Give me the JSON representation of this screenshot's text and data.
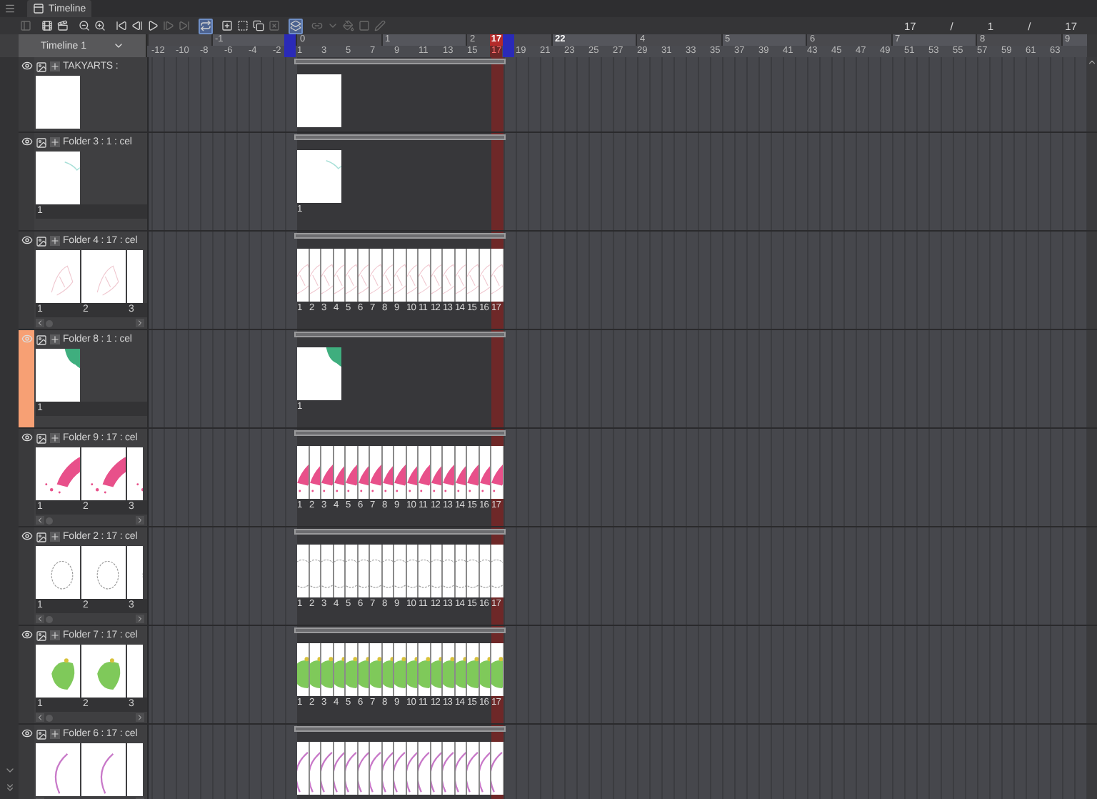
{
  "panel": {
    "tab": "Timeline"
  },
  "toolbar": {
    "buttons": [
      {
        "kind": "panel",
        "on": false,
        "disabled": true
      },
      {
        "kind": "frames",
        "on": false,
        "disabled": false
      },
      {
        "kind": "frames-plus",
        "on": false,
        "disabled": false
      },
      {
        "kind": "zoom-out",
        "on": false,
        "disabled": false
      },
      {
        "kind": "zoom-in",
        "on": false,
        "disabled": false
      },
      {
        "kind": "first",
        "on": false,
        "disabled": false
      },
      {
        "kind": "prev",
        "on": false,
        "disabled": false
      },
      {
        "kind": "play",
        "on": false,
        "disabled": false
      },
      {
        "kind": "next",
        "on": false,
        "disabled": true
      },
      {
        "kind": "last",
        "on": false,
        "disabled": true
      },
      {
        "kind": "loop",
        "on": true,
        "disabled": false
      },
      {
        "kind": "new-cel",
        "on": false,
        "disabled": false
      },
      {
        "kind": "specify-cel",
        "on": false,
        "disabled": false
      },
      {
        "kind": "copy-cel",
        "on": false,
        "disabled": false
      },
      {
        "kind": "clear-cel",
        "on": false,
        "disabled": true
      },
      {
        "kind": "onion",
        "on": true,
        "disabled": false
      },
      {
        "kind": "link",
        "on": false,
        "disabled": true
      },
      {
        "kind": "dropdown",
        "on": false,
        "disabled": true
      },
      {
        "kind": "fill",
        "on": false,
        "disabled": true
      },
      {
        "kind": "shape",
        "on": false,
        "disabled": true
      },
      {
        "kind": "pen",
        "on": false,
        "disabled": true
      }
    ],
    "counter": [
      "17",
      "/",
      "1",
      "/",
      "17"
    ]
  },
  "timeline_select": {
    "value": "Timeline 1"
  },
  "ruler": {
    "second_labels": [
      {
        "label": "-1",
        "highlighted": false
      },
      {
        "label": "0",
        "highlighted": false
      },
      {
        "label": "1",
        "highlighted": false
      },
      {
        "label": "2",
        "highlighted": false
      },
      {
        "label": "22",
        "highlighted": true
      },
      {
        "label": "4",
        "highlighted": false
      },
      {
        "label": "5",
        "highlighted": false
      },
      {
        "label": "6",
        "highlighted": false
      },
      {
        "label": "7",
        "highlighted": false
      },
      {
        "label": "8",
        "highlighted": false
      },
      {
        "label": "9",
        "highlighted": false
      }
    ],
    "playhead": {
      "label": "17"
    },
    "frame_labels": [
      {
        "label": "-12",
        "selected": false
      },
      {
        "label": "-10",
        "selected": false
      },
      {
        "label": "-8",
        "selected": false
      },
      {
        "label": "-6",
        "selected": false
      },
      {
        "label": "-4",
        "selected": false
      },
      {
        "label": "-2",
        "selected": false
      },
      {
        "label": "1",
        "selected": false
      },
      {
        "label": "3",
        "selected": false
      },
      {
        "label": "5",
        "selected": false
      },
      {
        "label": "7",
        "selected": false
      },
      {
        "label": "9",
        "selected": false
      },
      {
        "label": "11",
        "selected": false
      },
      {
        "label": "13",
        "selected": false
      },
      {
        "label": "15",
        "selected": false
      },
      {
        "label": "17",
        "selected": true
      },
      {
        "label": "19",
        "selected": false
      },
      {
        "label": "21",
        "selected": false
      },
      {
        "label": "23",
        "selected": false
      },
      {
        "label": "25",
        "selected": false
      },
      {
        "label": "27",
        "selected": false
      },
      {
        "label": "29",
        "selected": false
      },
      {
        "label": "31",
        "selected": false
      },
      {
        "label": "33",
        "selected": false
      },
      {
        "label": "35",
        "selected": false
      },
      {
        "label": "37",
        "selected": false
      },
      {
        "label": "39",
        "selected": false
      },
      {
        "label": "41",
        "selected": false
      },
      {
        "label": "43",
        "selected": false
      },
      {
        "label": "45",
        "selected": false
      },
      {
        "label": "47",
        "selected": false
      },
      {
        "label": "49",
        "selected": false
      },
      {
        "label": "51",
        "selected": false
      },
      {
        "label": "53",
        "selected": false
      },
      {
        "label": "55",
        "selected": false
      },
      {
        "label": "57",
        "selected": false
      },
      {
        "label": "59",
        "selected": false
      },
      {
        "label": "61",
        "selected": false
      },
      {
        "label": "63",
        "selected": false
      }
    ]
  },
  "tracks": [
    {
      "name": "TAKYARTS :",
      "visible": true,
      "selected": false,
      "kind": "single",
      "thumbs": [
        {
          "kind": "blank"
        }
      ],
      "cels": [
        {
          "kind": "blank"
        }
      ]
    },
    {
      "name": "Folder 3 : 1 : cel",
      "visible": true,
      "selected": false,
      "kind": "single",
      "thumbs": [
        {
          "kind": "teal",
          "label": "1"
        }
      ],
      "cels": [
        {
          "kind": "teal",
          "label": "1"
        }
      ]
    },
    {
      "name": "Folder 4 : 17 : cel",
      "visible": true,
      "selected": false,
      "kind": "sequence",
      "thumbs": [
        {
          "kind": "sketch",
          "label": "1"
        },
        {
          "kind": "sketch",
          "label": "2"
        },
        {
          "kind": "sketch",
          "label": "3"
        }
      ],
      "cels": [
        {
          "kind": "sketch",
          "label": "1"
        },
        {
          "kind": "sketch",
          "label": "2"
        },
        {
          "kind": "sketch",
          "label": "3"
        },
        {
          "kind": "sketch",
          "label": "4"
        },
        {
          "kind": "sketch",
          "label": "5"
        },
        {
          "kind": "sketch",
          "label": "6"
        },
        {
          "kind": "sketch",
          "label": "7"
        },
        {
          "kind": "sketch",
          "label": "8"
        },
        {
          "kind": "sketch",
          "label": "9"
        },
        {
          "kind": "sketch",
          "label": "10"
        },
        {
          "kind": "sketch",
          "label": "11"
        },
        {
          "kind": "sketch",
          "label": "12"
        },
        {
          "kind": "sketch",
          "label": "13"
        },
        {
          "kind": "sketch",
          "label": "14"
        },
        {
          "kind": "sketch",
          "label": "15"
        },
        {
          "kind": "sketch",
          "label": "16"
        },
        {
          "kind": "sketch",
          "label": "17"
        }
      ]
    },
    {
      "name": "Folder 8 : 1 : cel",
      "visible": true,
      "selected": true,
      "kind": "single",
      "thumbs": [
        {
          "kind": "corner",
          "label": "1"
        }
      ],
      "cels": [
        {
          "kind": "corner",
          "label": "1"
        }
      ]
    },
    {
      "name": "Folder 9 : 17 : cel",
      "visible": true,
      "selected": false,
      "kind": "sequence",
      "thumbs": [
        {
          "kind": "splash",
          "label": "1"
        },
        {
          "kind": "splash",
          "label": "2"
        },
        {
          "kind": "splash",
          "label": "3"
        }
      ],
      "cels": [
        {
          "kind": "splash",
          "label": "1"
        },
        {
          "kind": "splash",
          "label": "2"
        },
        {
          "kind": "splash",
          "label": "3"
        },
        {
          "kind": "splash",
          "label": "4"
        },
        {
          "kind": "splash",
          "label": "5"
        },
        {
          "kind": "splash",
          "label": "6"
        },
        {
          "kind": "splash",
          "label": "7"
        },
        {
          "kind": "splash",
          "label": "8"
        },
        {
          "kind": "splash",
          "label": "9"
        },
        {
          "kind": "splash",
          "label": "10"
        },
        {
          "kind": "splash",
          "label": "11"
        },
        {
          "kind": "splash",
          "label": "12"
        },
        {
          "kind": "splash",
          "label": "13"
        },
        {
          "kind": "splash",
          "label": "14"
        },
        {
          "kind": "splash",
          "label": "15"
        },
        {
          "kind": "splash",
          "label": "16"
        },
        {
          "kind": "splash",
          "label": "17"
        }
      ]
    },
    {
      "name": "Folder 2 : 17 : cel",
      "visible": true,
      "selected": false,
      "kind": "sequence",
      "thumbs": [
        {
          "kind": "oval",
          "label": "1"
        },
        {
          "kind": "oval",
          "label": "2"
        },
        {
          "kind": "oval",
          "label": "3"
        }
      ],
      "cels": [
        {
          "kind": "oval",
          "label": "1"
        },
        {
          "kind": "oval",
          "label": "2"
        },
        {
          "kind": "oval",
          "label": "3"
        },
        {
          "kind": "oval",
          "label": "4"
        },
        {
          "kind": "oval",
          "label": "5"
        },
        {
          "kind": "oval",
          "label": "6"
        },
        {
          "kind": "oval",
          "label": "7"
        },
        {
          "kind": "oval",
          "label": "8"
        },
        {
          "kind": "oval",
          "label": "9"
        },
        {
          "kind": "oval",
          "label": "10"
        },
        {
          "kind": "oval",
          "label": "11"
        },
        {
          "kind": "oval",
          "label": "12"
        },
        {
          "kind": "oval",
          "label": "13"
        },
        {
          "kind": "oval",
          "label": "14"
        },
        {
          "kind": "oval",
          "label": "15"
        },
        {
          "kind": "oval",
          "label": "16"
        },
        {
          "kind": "oval",
          "label": "17"
        }
      ]
    },
    {
      "name": "Folder 7 : 17 : cel",
      "visible": true,
      "selected": false,
      "kind": "sequence",
      "thumbs": [
        {
          "kind": "blob",
          "label": "1"
        },
        {
          "kind": "blob",
          "label": "2"
        },
        {
          "kind": "blob",
          "label": "3"
        }
      ],
      "cels": [
        {
          "kind": "blob",
          "label": "1"
        },
        {
          "kind": "blob",
          "label": "2"
        },
        {
          "kind": "blob",
          "label": "3"
        },
        {
          "kind": "blob",
          "label": "4"
        },
        {
          "kind": "blob",
          "label": "5"
        },
        {
          "kind": "blob",
          "label": "6"
        },
        {
          "kind": "blob",
          "label": "7"
        },
        {
          "kind": "blob",
          "label": "8"
        },
        {
          "kind": "blob",
          "label": "9"
        },
        {
          "kind": "blob",
          "label": "10"
        },
        {
          "kind": "blob",
          "label": "11"
        },
        {
          "kind": "blob",
          "label": "12"
        },
        {
          "kind": "blob",
          "label": "13"
        },
        {
          "kind": "blob",
          "label": "14"
        },
        {
          "kind": "blob",
          "label": "15"
        },
        {
          "kind": "blob",
          "label": "16"
        },
        {
          "kind": "blob",
          "label": "17"
        }
      ]
    },
    {
      "name": "Folder 6 : 17 : cel",
      "visible": true,
      "selected": false,
      "kind": "sequence",
      "thumbs": [
        {
          "kind": "curve"
        },
        {
          "kind": "curve"
        },
        {
          "kind": "curve"
        }
      ],
      "cels": [
        {
          "kind": "curve"
        },
        {
          "kind": "curve"
        },
        {
          "kind": "curve"
        },
        {
          "kind": "curve"
        },
        {
          "kind": "curve"
        },
        {
          "kind": "curve"
        },
        {
          "kind": "curve"
        },
        {
          "kind": "curve"
        },
        {
          "kind": "curve"
        },
        {
          "kind": "curve"
        },
        {
          "kind": "curve"
        },
        {
          "kind": "curve"
        },
        {
          "kind": "curve"
        },
        {
          "kind": "curve"
        },
        {
          "kind": "curve"
        },
        {
          "kind": "curve"
        },
        {
          "kind": "curve"
        }
      ]
    }
  ]
}
